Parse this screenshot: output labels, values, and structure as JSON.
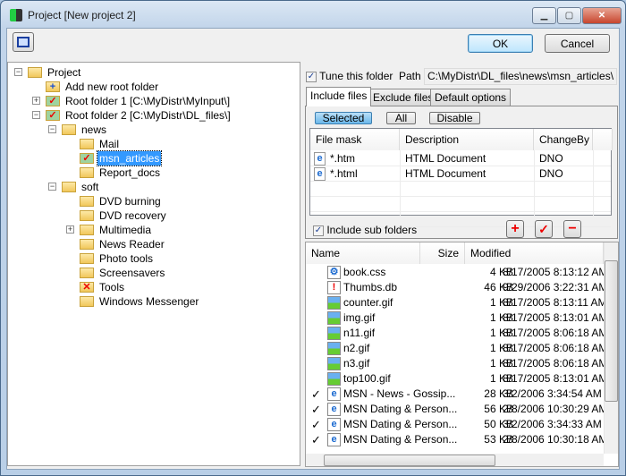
{
  "window": {
    "title": "Project [New project 2]",
    "minimize": "▁",
    "maximize": "▢",
    "close": "✕"
  },
  "toolbar": {
    "ok": "OK",
    "cancel": "Cancel"
  },
  "tree": [
    {
      "label": "Project",
      "level": 0,
      "expander": "−",
      "icon": "folder"
    },
    {
      "label": "Add new root folder",
      "level": 1,
      "icon": "folder-add"
    },
    {
      "label": "Root folder 1 [C:\\MyDistr\\MyInput\\]",
      "level": 1,
      "expander": "+",
      "icon": "folder-checked"
    },
    {
      "label": "Root folder 2 [C:\\MyDistr\\DL_files\\]",
      "level": 1,
      "expander": "−",
      "icon": "folder-checked"
    },
    {
      "label": "news",
      "level": 2,
      "expander": "−",
      "icon": "folder"
    },
    {
      "label": "Mail",
      "level": 3,
      "icon": "folder"
    },
    {
      "label": "msn_articles",
      "level": 3,
      "icon": "folder-checked",
      "selected": true
    },
    {
      "label": "Report_docs",
      "level": 3,
      "icon": "folder"
    },
    {
      "label": "soft",
      "level": 2,
      "expander": "−",
      "icon": "folder"
    },
    {
      "label": "DVD burning",
      "level": 3,
      "icon": "folder"
    },
    {
      "label": "DVD recovery",
      "level": 3,
      "icon": "folder"
    },
    {
      "label": "Multimedia",
      "level": 3,
      "expander": "+",
      "icon": "folder"
    },
    {
      "label": "News Reader",
      "level": 3,
      "icon": "folder"
    },
    {
      "label": "Photo tools",
      "level": 3,
      "icon": "folder"
    },
    {
      "label": "Screensavers",
      "level": 3,
      "icon": "folder"
    },
    {
      "label": "Tools",
      "level": 3,
      "icon": "folder-excluded"
    },
    {
      "label": "Windows Messenger",
      "level": 3,
      "icon": "folder"
    }
  ],
  "tune": {
    "checkbox_label": "Tune this folder",
    "checked": true,
    "path_label": "Path",
    "path_value": "C:\\MyDistr\\DL_files\\news\\msn_articles\\"
  },
  "tabs": [
    "Include files",
    "Exclude files",
    "Default options"
  ],
  "mode_buttons": [
    "Selected",
    "All",
    "Disable"
  ],
  "mask_grid": {
    "columns": [
      "File mask",
      "Description",
      "ChangeBy"
    ],
    "rows": [
      [
        "*.htm",
        "HTML Document",
        "DNO"
      ],
      [
        "*.html",
        "HTML Document",
        "DNO"
      ]
    ]
  },
  "include_sub": {
    "label": "Include sub folders",
    "checked": true
  },
  "files": {
    "columns": [
      "Name",
      "Size",
      "Modified"
    ],
    "rows": [
      {
        "check": "",
        "icon": "css",
        "name": "book.css",
        "size": "4 KB",
        "modified": "8/17/2005 8:13:12 AM"
      },
      {
        "check": "",
        "icon": "warning",
        "name": "Thumbs.db",
        "size": "46 KB",
        "modified": "9/29/2006 3:22:31 AM"
      },
      {
        "check": "",
        "icon": "image",
        "name": "counter.gif",
        "size": "1 KB",
        "modified": "8/17/2005 8:13:11 AM"
      },
      {
        "check": "",
        "icon": "image",
        "name": "img.gif",
        "size": "1 KB",
        "modified": "8/17/2005 8:13:01 AM"
      },
      {
        "check": "",
        "icon": "image",
        "name": "n11.gif",
        "size": "1 KB",
        "modified": "8/17/2005 8:06:18 AM"
      },
      {
        "check": "",
        "icon": "image",
        "name": "n2.gif",
        "size": "1 KB",
        "modified": "8/17/2005 8:06:18 AM"
      },
      {
        "check": "",
        "icon": "image",
        "name": "n3.gif",
        "size": "1 KB",
        "modified": "8/17/2005 8:06:18 AM"
      },
      {
        "check": "",
        "icon": "image",
        "name": "top100.gif",
        "size": "1 KB",
        "modified": "8/17/2005 8:13:01 AM"
      },
      {
        "check": "✓",
        "icon": "ie",
        "name": "MSN - News - Gossip...",
        "size": "28 KB",
        "modified": "3/2/2006 3:34:54 AM"
      },
      {
        "check": "✓",
        "icon": "ie",
        "name": "MSN Dating & Person...",
        "size": "56 KB",
        "modified": "2/8/2006 10:30:29 AM"
      },
      {
        "check": "✓",
        "icon": "ie",
        "name": "MSN Dating & Person...",
        "size": "50 KB",
        "modified": "3/2/2006 3:34:33 AM"
      },
      {
        "check": "✓",
        "icon": "ie",
        "name": "MSN Dating & Person...",
        "size": "53 KB",
        "modified": "2/8/2006 10:30:18 AM"
      }
    ]
  },
  "colors": {
    "selection": "#3399ff",
    "accent": "#3c7fb1"
  }
}
